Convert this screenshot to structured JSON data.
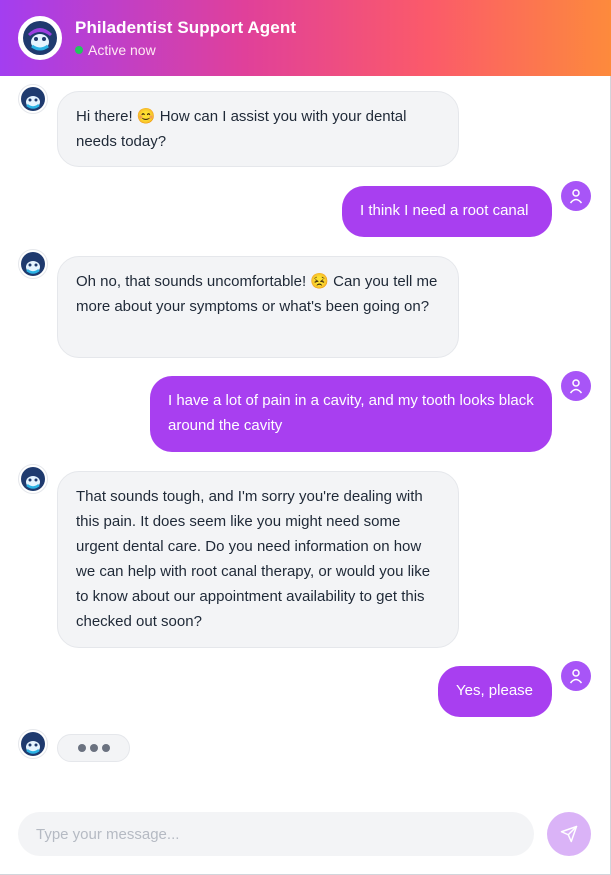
{
  "header": {
    "title": "Philadentist Support Agent",
    "status": "Active now"
  },
  "messages": [
    {
      "role": "bot",
      "text": "Hi there! 😊 How can I assist you with your dental needs today?"
    },
    {
      "role": "user",
      "text": "I think I need a root canal"
    },
    {
      "role": "bot",
      "text": "Oh no, that sounds uncomfortable! 😣 Can you tell me more about your symptoms or what's been going on?"
    },
    {
      "role": "user",
      "text": "I have a lot of pain in a cavity, and my tooth looks black around the cavity"
    },
    {
      "role": "bot",
      "text": "That sounds tough, and I'm sorry you're dealing with this pain. It does seem like you might need some urgent dental care. Do you need information on how we can help with root canal therapy, or would you like to know about our appointment availability to get this checked out soon?"
    },
    {
      "role": "user",
      "text": "Yes, please"
    }
  ],
  "composer": {
    "placeholder": "Type your message..."
  },
  "icons": {
    "bot_avatar": "bot-mascot-icon",
    "user_avatar": "user-icon",
    "send": "send-icon"
  },
  "colors": {
    "accent": "#a83ff0",
    "status": "#22c55e",
    "header_gradient": [
      "#a33ef0",
      "#e0409a",
      "#fd8a3c"
    ]
  }
}
